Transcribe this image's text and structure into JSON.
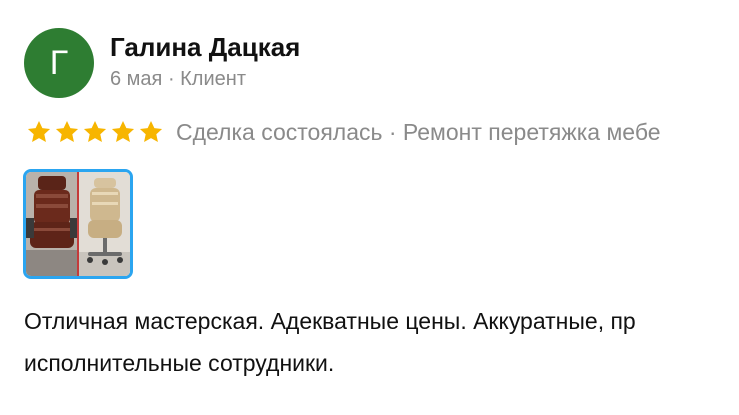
{
  "review": {
    "avatar_letter": "Г",
    "author_name": "Галина Дацкая",
    "meta": "6 мая · Клиент",
    "rating_stars": 5,
    "deal_text": "Сделка состоялась · Ремонт перетяжка мебе",
    "photo_icon": "before-after-chair-photo",
    "text_line_1": "Отличная мастерская. Адекватные цены. Аккуратные, пр",
    "text_line_2": "исполнительные сотрудники."
  },
  "colors": {
    "avatar_bg": "#2e7d32",
    "star": "#f7b500",
    "photo_border": "#2ba5f0",
    "muted_text": "#8a8a8a"
  }
}
